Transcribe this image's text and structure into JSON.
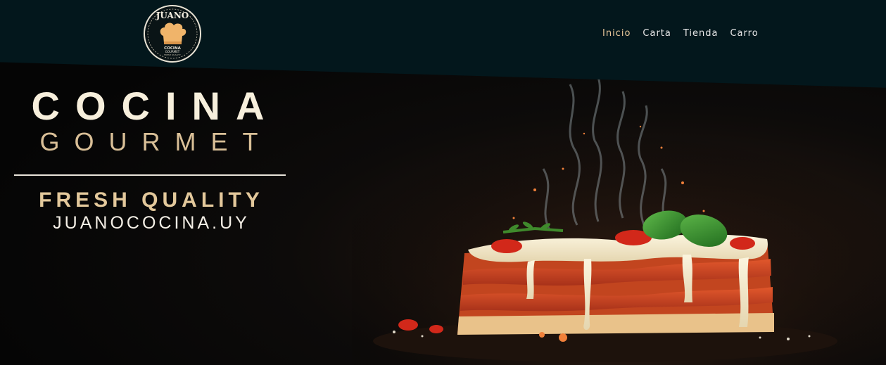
{
  "logo": {
    "brand_name": "JUANO",
    "line1": "COCINA",
    "line2": "GOURMET",
    "line3": "FRESH QUALITY"
  },
  "nav": {
    "items": [
      {
        "label": "Inicio",
        "active": true
      },
      {
        "label": "Carta",
        "active": false
      },
      {
        "label": "Tienda",
        "active": false
      },
      {
        "label": "Carro",
        "active": false
      }
    ]
  },
  "hero": {
    "title_line1": "COCINA",
    "title_line2": "GOURMET",
    "tagline": "FRESH QUALITY",
    "website": "JUANOCOCINA.UY"
  },
  "colors": {
    "header_bg": "#03171c",
    "nav_active": "#e8c79a",
    "nav_text": "#e7e7e7",
    "title_cream": "#f7efdc",
    "title_gold": "#d9bf97"
  },
  "icons": {
    "logo_mark": "chef-hat-icon"
  }
}
